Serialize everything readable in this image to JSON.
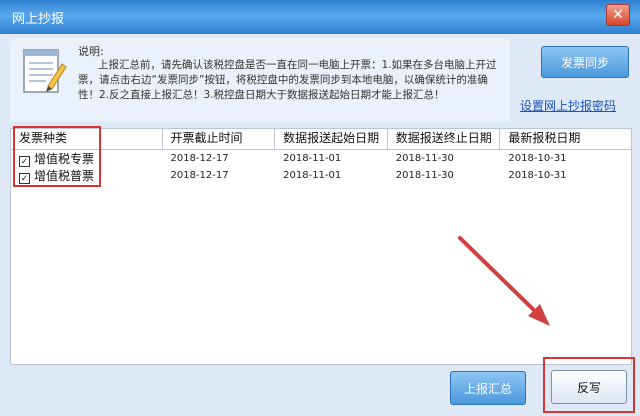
{
  "window": {
    "title": "网上抄报",
    "close_symbol": "✕"
  },
  "info": {
    "label": "说明:",
    "text": "上报汇总前，请先确认该税控盘是否一直在同一电脑上开票：1.如果在多台电脑上开过票，请点击右边“发票同步”按钮，将税控盘中的发票同步到本地电脑，以确保统计的准确性！2.反之直接上报汇总！3.税控盘日期大于数据报送起始日期才能上报汇总！"
  },
  "buttons": {
    "sync": "发票同步",
    "report_summary": "上报汇总",
    "reversal": "反写"
  },
  "links": {
    "set_password": "设置网上抄报密码"
  },
  "table": {
    "columns": [
      "发票种类",
      "开票截止时间",
      "数据报送起始日期",
      "数据报送终止日期",
      "最新报税日期"
    ],
    "rows": [
      {
        "checked": true,
        "check_symbol": "✓",
        "type": "增值税专票",
        "deadline": "2018-12-17",
        "start": "2018-11-01",
        "end": "2018-11-30",
        "latest": "2018-10-31"
      },
      {
        "checked": true,
        "check_symbol": "✓",
        "type": "增值税普票",
        "deadline": "2018-12-17",
        "start": "2018-11-01",
        "end": "2018-11-30",
        "latest": "2018-10-31"
      }
    ]
  },
  "colors": {
    "title_bar": "#3a8ad8",
    "highlight": "#d93434",
    "arrow": "#d04040",
    "link": "#1b55b8"
  }
}
